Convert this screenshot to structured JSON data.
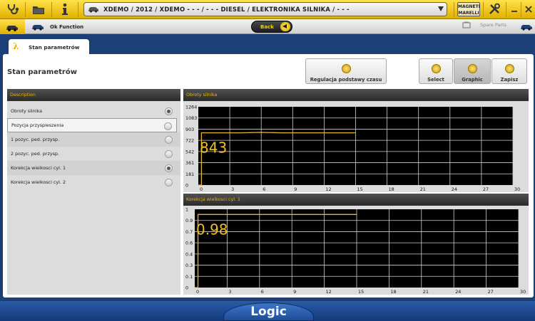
{
  "topbar": {
    "vehicle_path": "XDEMO / 2012 / XDEMO - - - / - - - DIESEL / ELEKTRONIKA SILNIKA / - - -",
    "brand_logo_text": "MAGNETI MARELLI",
    "icons": [
      "stethoscope-icon",
      "folder-icon",
      "info-icon",
      "car-icon",
      "tools-icon",
      "minimize-icon",
      "close-icon"
    ]
  },
  "subbar": {
    "ok_function_label": "Ok Function",
    "back_label": "Back",
    "spare_parts_label": "Spare Parts"
  },
  "tab": {
    "label": "Stan parametrów"
  },
  "page": {
    "title": "Stan parametrów"
  },
  "toolbar": {
    "regulacja_label": "Regulacja podstawy czasu",
    "select_label": "Select",
    "graphic_label": "Graphic",
    "zapisz_label": "Zapisz"
  },
  "description": {
    "header": "Description",
    "items": [
      {
        "label": "Obroty silnika",
        "checked": true
      },
      {
        "label": "Pozycja przyspieszenia",
        "checked": false
      },
      {
        "label": "1 pozyc. ped. przysp.",
        "checked": false
      },
      {
        "label": "2 pozyc. ped. przysp.",
        "checked": false
      },
      {
        "label": "Korekcja wielkosci cyl. 1",
        "checked": true
      },
      {
        "label": "Korekcja wielkosci cyl. 2",
        "checked": false
      }
    ]
  },
  "footer": {
    "logo": "Logic"
  },
  "colors": {
    "accent": "#f0c020",
    "topbar": "#f5cd1f",
    "footer": "#1c4a8f"
  },
  "chart_data": [
    {
      "type": "line",
      "title": "Obroty silnika",
      "current_value": "843",
      "ytick_labels": [
        "0",
        "181",
        "361",
        "542",
        "722",
        "903",
        "1083",
        "1264"
      ],
      "ylim": [
        0,
        1264
      ],
      "xlim": [
        0,
        30
      ],
      "xticks": [
        0,
        3,
        6,
        9,
        12,
        15,
        18,
        21,
        24,
        27,
        30
      ],
      "grid": true,
      "x": [
        0,
        0.3,
        0.3,
        2,
        4,
        6,
        8,
        10,
        12,
        14,
        15
      ],
      "y": [
        0,
        0,
        843,
        843,
        843,
        850,
        843,
        843,
        843,
        843,
        843
      ]
    },
    {
      "type": "line",
      "title": "Korekcja wielkosci cyl. 1",
      "current_value": "0.98",
      "ytick_labels": [
        "0",
        "0.1",
        "0.3",
        "0.4",
        "0.6",
        "0.7",
        "0.9",
        "1"
      ],
      "ylim": [
        0,
        1.05
      ],
      "xlim": [
        0,
        30
      ],
      "xticks": [
        0,
        3,
        6,
        9,
        12,
        15,
        18,
        21,
        24,
        27,
        30
      ],
      "grid": true,
      "x": [
        0,
        0.3,
        0.3,
        2,
        4,
        6,
        8,
        10,
        12,
        14,
        15
      ],
      "y": [
        0,
        0,
        0.98,
        0.98,
        0.98,
        0.98,
        0.98,
        0.98,
        0.98,
        0.98,
        0.98
      ]
    }
  ]
}
